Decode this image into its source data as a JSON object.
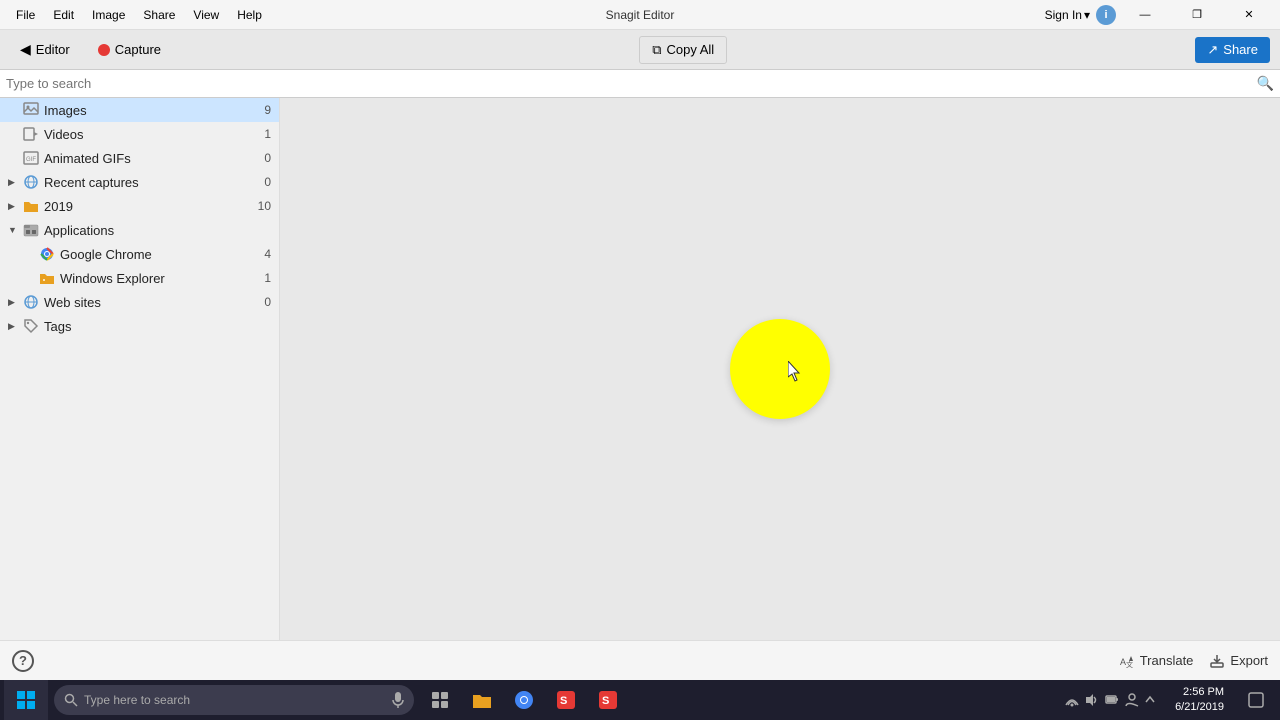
{
  "titlebar": {
    "title": "Snagit Editor",
    "menu_items": [
      "File",
      "Edit",
      "Image",
      "Share",
      "View",
      "Help"
    ],
    "sign_in": "Sign In",
    "info_label": "i"
  },
  "toolbar": {
    "editor_label": "Editor",
    "capture_label": "Capture",
    "copy_all_label": "Copy All",
    "share_label": "Share"
  },
  "search": {
    "placeholder": "Type to search"
  },
  "sidebar": {
    "items": [
      {
        "label": "Images",
        "count": "9",
        "indent": 0,
        "type": "images",
        "active": true
      },
      {
        "label": "Videos",
        "count": "1",
        "indent": 0,
        "type": "videos"
      },
      {
        "label": "Animated GIFs",
        "count": "0",
        "indent": 0,
        "type": "gif"
      },
      {
        "label": "Recent captures",
        "count": "0",
        "indent": 0,
        "type": "globe",
        "expandable": true
      },
      {
        "label": "2019",
        "count": "10",
        "indent": 0,
        "type": "folder",
        "expandable": true
      },
      {
        "label": "Applications",
        "count": "",
        "indent": 0,
        "type": "app-folder",
        "expandable": true,
        "expanded": true
      },
      {
        "label": "Google Chrome",
        "count": "4",
        "indent": 2,
        "type": "chrome"
      },
      {
        "label": "Windows Explorer",
        "count": "1",
        "indent": 2,
        "type": "folder-small"
      },
      {
        "label": "Web sites",
        "count": "0",
        "indent": 0,
        "type": "globe",
        "expandable": true
      },
      {
        "label": "Tags",
        "count": "",
        "indent": 0,
        "type": "tag",
        "expandable": true
      }
    ]
  },
  "statusbar": {
    "help_label": "?",
    "translate_label": "Translate",
    "export_label": "Export"
  },
  "taskbar": {
    "search_placeholder": "Type here to search",
    "time": "2:56 PM",
    "date": "6/21/2019"
  },
  "window_controls": {
    "minimize": "—",
    "maximize": "❐",
    "close": "✕"
  }
}
